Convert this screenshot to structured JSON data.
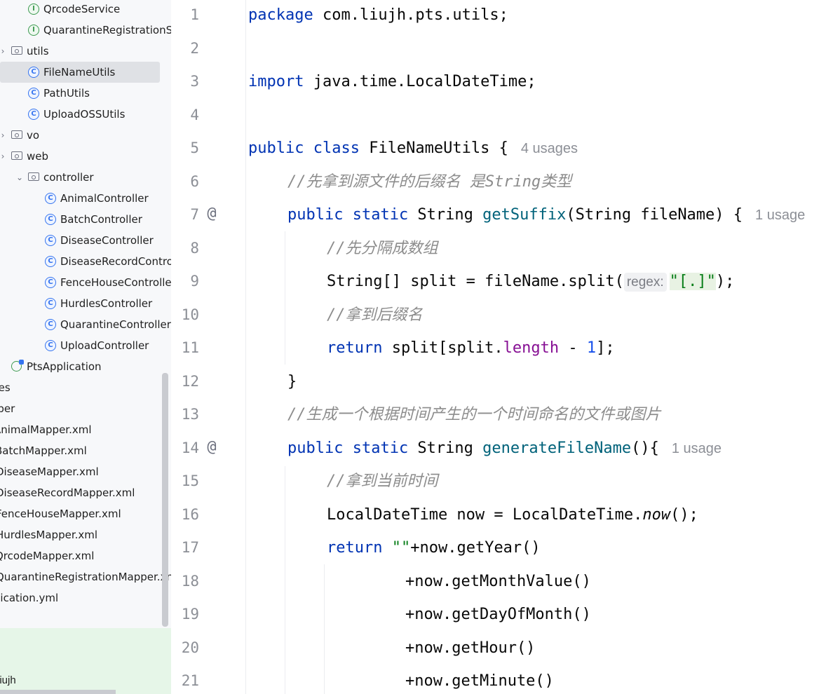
{
  "sidebar": {
    "items": [
      {
        "label": "QrcodeService",
        "kind": "interface"
      },
      {
        "label": "QuarantineRegistrationService",
        "kind": "interface"
      },
      {
        "label": "utils",
        "kind": "folder"
      },
      {
        "label": "FileNameUtils",
        "kind": "class"
      },
      {
        "label": "PathUtils",
        "kind": "class"
      },
      {
        "label": "UploadOSSUtils",
        "kind": "class"
      },
      {
        "label": "vo",
        "kind": "folder"
      },
      {
        "label": "web",
        "kind": "folder"
      },
      {
        "label": "controller",
        "kind": "folder"
      },
      {
        "label": "AnimalController",
        "kind": "class"
      },
      {
        "label": "BatchController",
        "kind": "class"
      },
      {
        "label": "DiseaseController",
        "kind": "class"
      },
      {
        "label": "DiseaseRecordController",
        "kind": "class"
      },
      {
        "label": "FenceHouseController",
        "kind": "class"
      },
      {
        "label": "HurdlesController",
        "kind": "class"
      },
      {
        "label": "QuarantineController",
        "kind": "class"
      },
      {
        "label": "UploadController",
        "kind": "class"
      },
      {
        "label": "PtsApplication",
        "kind": "app"
      },
      {
        "label": "resources",
        "kind": "folder"
      },
      {
        "label": "mapper",
        "kind": "folder"
      },
      {
        "label": "AnimalMapper.xml",
        "kind": "xml"
      },
      {
        "label": "BatchMapper.xml",
        "kind": "xml"
      },
      {
        "label": "DiseaseMapper.xml",
        "kind": "xml"
      },
      {
        "label": "DiseaseRecordMapper.xml",
        "kind": "xml"
      },
      {
        "label": "FenceHouseMapper.xml",
        "kind": "xml"
      },
      {
        "label": "HurdlesMapper.xml",
        "kind": "xml"
      },
      {
        "label": "QrcodeMapper.xml",
        "kind": "xml"
      },
      {
        "label": "QuarantineRegistrationMapper.xml",
        "kind": "xml"
      },
      {
        "label": "application.yml",
        "kind": "yml"
      }
    ],
    "bottom_label": "liujh"
  },
  "editor": {
    "line_numbers": [
      "1",
      "2",
      "3",
      "4",
      "5",
      "6",
      "7",
      "8",
      "9",
      "10",
      "11",
      "12",
      "13",
      "14",
      "15",
      "16",
      "17",
      "18",
      "19",
      "20",
      "21"
    ],
    "tokens": {
      "l1_kw": "package",
      "l1_rest": " com.liujh.pts.utils;",
      "l3_kw": "import",
      "l3_rest": " java.time.LocalDateTime;",
      "l5_kw": "public class",
      "l5_rest": " FileNameUtils {",
      "l5_hint": "4 usages",
      "l6_comment": "//先拿到源文件的后缀名 是String类型",
      "l7_kw": "public static",
      "l7_type": " String ",
      "l7_fn": "getSuffix",
      "l7_rest": "(String fileName) {",
      "l7_hint": "1 usage",
      "l8_comment": "//先分隔成数组",
      "l9_pre": "String[] split = fileName.split(",
      "l9_param": "regex:",
      "l9_str": "\"[.]\"",
      "l9_post": ");",
      "l10_comment": "//拿到后缀名",
      "l11_kw": "return",
      "l11_a": " split[split.",
      "l11_field": "length",
      "l11_b": " - ",
      "l11_num": "1",
      "l11_c": "];",
      "l12_brace": "}",
      "l13_comment": "//生成一个根据时间产生的一个时间命名的文件或图片",
      "l14_kw": "public static",
      "l14_type": " String ",
      "l14_fn": "generateFileName",
      "l14_rest": "(){",
      "l14_hint": "1 usage",
      "l15_comment": "//拿到当前时间",
      "l16_a": "LocalDateTime now = LocalDateTime.",
      "l16_it": "now",
      "l16_b": "();",
      "l17_kw": "return",
      "l17_str": " \"\"",
      "l17_rest": "+now.getYear()",
      "l18": "+now.getMonthValue()",
      "l19": "+now.getDayOfMonth()",
      "l20": "+now.getHour()",
      "l21": "+now.getMinute()"
    },
    "gutter_marker": "@"
  }
}
